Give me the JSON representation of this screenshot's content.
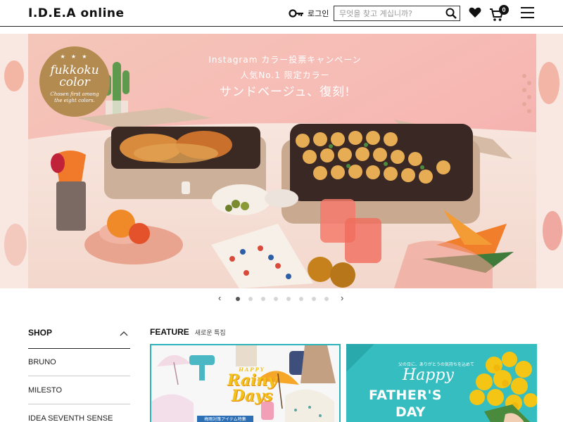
{
  "header": {
    "logo": "I.D.E.A online",
    "login_label": "로그인",
    "search_placeholder": "무엇을 찾고 계십니까?",
    "cart_count": "0",
    "icons": [
      "key-icon",
      "search-icon",
      "heart-icon",
      "cart-icon",
      "menu-icon"
    ]
  },
  "hero": {
    "badge_title": "fukkoku color",
    "badge_sub": "Chosen first among the eight colors.",
    "copy_line1": "Instagram カラー投票キャンペーン",
    "copy_line2": "人気No.1 限定カラー",
    "copy_line3": "サンドベージュ、復刻!",
    "slide_count": 8,
    "active_slide": 1
  },
  "carousel": {
    "prev": "‹",
    "next": "›"
  },
  "shop": {
    "title": "SHOP",
    "items": [
      "BRUNO",
      "MILESTO",
      "IDEA SEVENTH SENSE"
    ]
  },
  "feature": {
    "title": "FEATURE",
    "subtitle": "새로운 특집",
    "cards": [
      {
        "top": "HAPPY",
        "main1": "Rainy",
        "main2": "Days",
        "strip": "梅雨対策アイテム特集"
      },
      {
        "small": "父の日に、ありがとうの気持ちを込めて",
        "happy": "Happy",
        "line1": "FATHER'S",
        "line2": "DAY"
      }
    ]
  },
  "colors": {
    "teal": "#36bdc0",
    "hero_pink": "#f6bfb6",
    "accent_dark": "#111111"
  }
}
